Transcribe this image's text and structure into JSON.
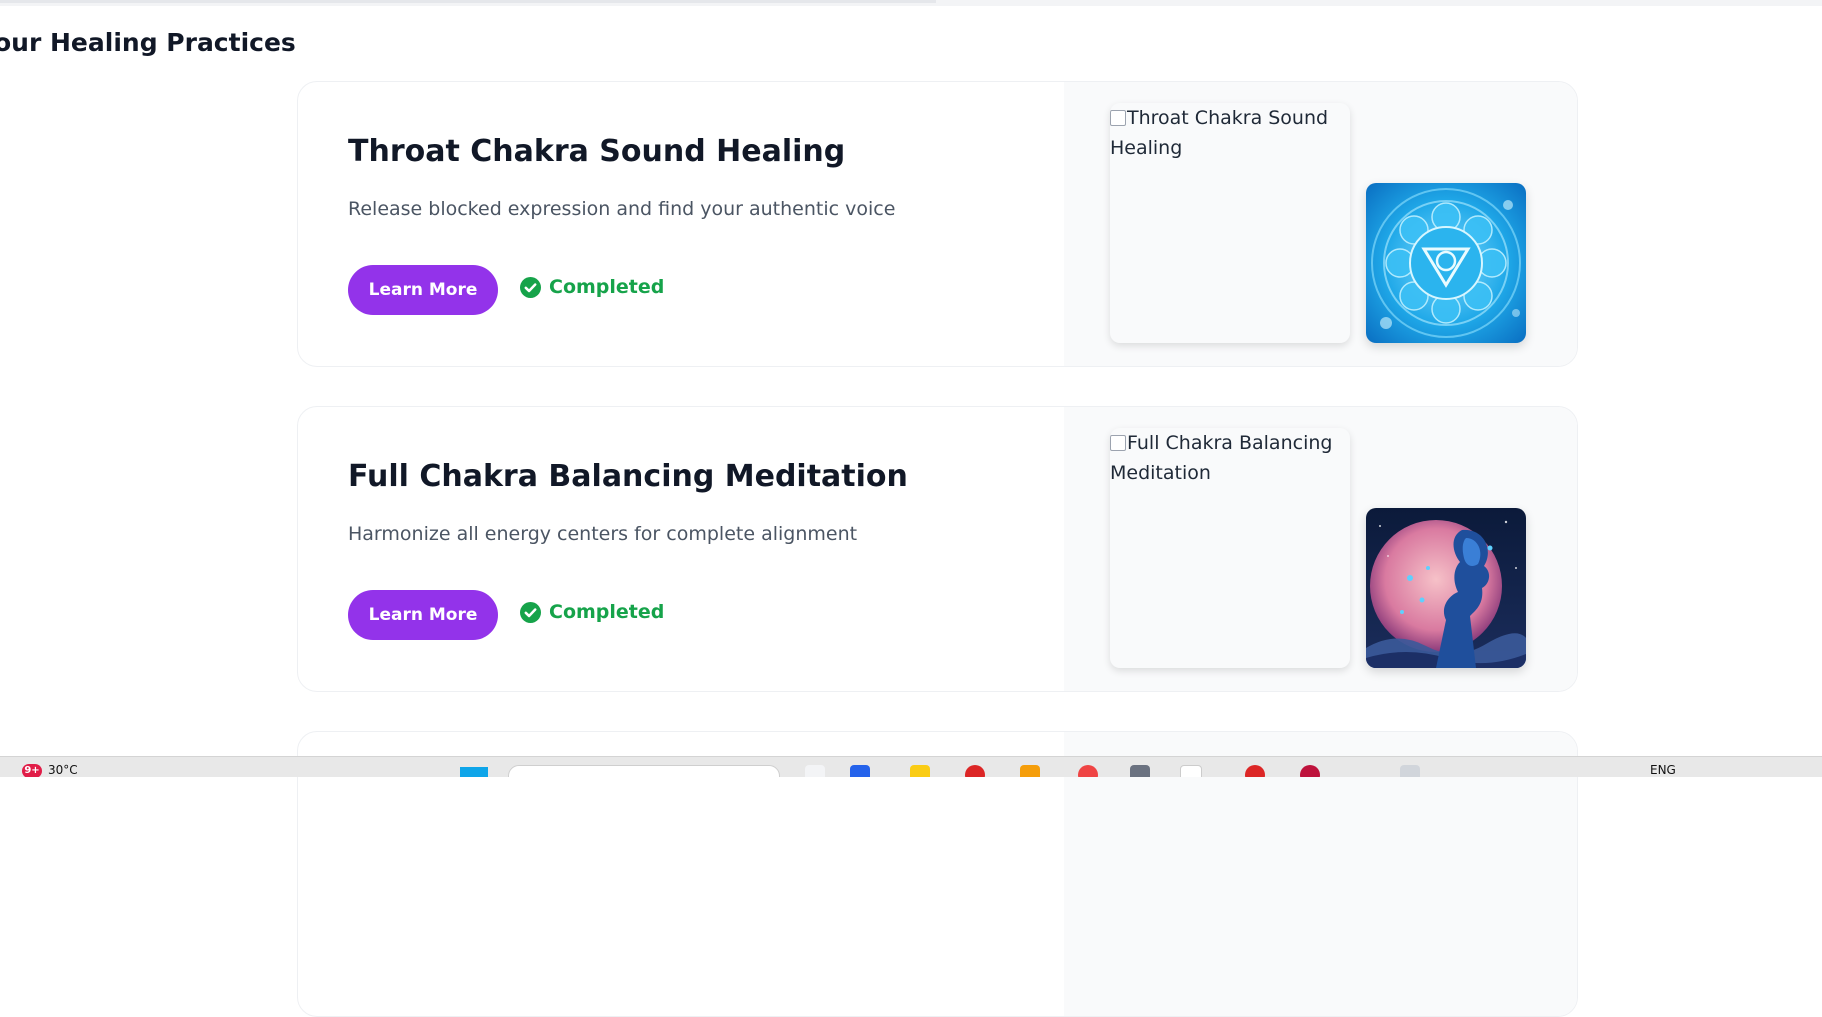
{
  "page": {
    "section_title": "our Healing Practices"
  },
  "practices": [
    {
      "title": "Throat Chakra Sound Healing",
      "description": "Release blocked expression and find your authentic voice",
      "button_label": "Learn More",
      "status_label": "Completed",
      "broken_image_alt": "Throat Chakra Sound Healing",
      "thumbnail_icon": "throat-chakra-symbol"
    },
    {
      "title": "Full Chakra Balancing Meditation",
      "description": "Harmonize all energy centers for complete alignment",
      "button_label": "Learn More",
      "status_label": "Completed",
      "broken_image_alt": "Full Chakra Balancing Meditation",
      "thumbnail_icon": "meditating-woman-moon"
    }
  ],
  "taskbar": {
    "weather_badge": "9+",
    "weather_temp": "30°C",
    "language": "ENG"
  },
  "colors": {
    "accent_purple": "#9333ea",
    "status_green": "#16a34a",
    "title_text": "#111827",
    "description_text": "#4b5563"
  }
}
